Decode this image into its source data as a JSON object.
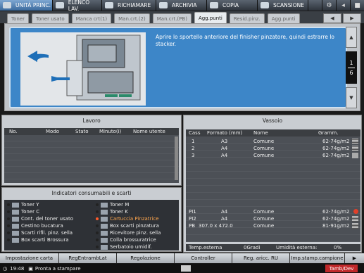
{
  "topbar": {
    "buttons": [
      "UNITÀ PRINC.",
      "ELENCO LAV.",
      "RICHIAMARE",
      "ARCHIVIA",
      "COPIA",
      "SCANSIONE"
    ]
  },
  "tabs": [
    "Toner",
    "Toner usato",
    "Manca crt(1)",
    "Man.crt.(2)",
    "Man.crt.(PB)",
    "Agg.punti",
    "Resid.pinz.",
    "Agg.punti"
  ],
  "message": "Aprire lo sportello anteriore del finisher pinzatore, quindi estrarre lo stacker.",
  "pager": {
    "current": "1",
    "total": "6"
  },
  "lavoro": {
    "title": "Lavoro",
    "columns": [
      "No.",
      "Modo",
      "Stato",
      "Minuto(i)",
      "Nome utente"
    ]
  },
  "consumabili": {
    "title": "Indicatori consumabili e scarti",
    "left": [
      "Toner Y",
      "Toner C",
      "Cont. del toner usato",
      "Cestino bucatura",
      "Scarti rifil. pinz. sella",
      "Box scarti Brossura"
    ],
    "right": [
      "Toner M",
      "Toner K",
      "Cartuccia Pinzatrice",
      "Box scarti pinzatura",
      "Ricevitore pinz. sella",
      "Colla brossuratrice",
      "Serbatoio umidif."
    ]
  },
  "vassoio": {
    "title": "Vassoio",
    "columns": [
      "Cass",
      "Formato (mm)",
      "Nome",
      "Gramm."
    ],
    "rows": [
      {
        "cass": "1",
        "formato": "A3",
        "nome": "Comune",
        "gramm": "62-74g/m2"
      },
      {
        "cass": "2",
        "formato": "A4",
        "nome": "Comune",
        "gramm": "62-74g/m2"
      },
      {
        "cass": "3",
        "formato": "A4",
        "nome": "Comune",
        "gramm": "62-74g/m2"
      },
      {
        "cass": "PI1",
        "formato": "A4",
        "nome": "Comune",
        "gramm": "62-74g/m2"
      },
      {
        "cass": "PI2",
        "formato": "A4",
        "nome": "Comune",
        "gramm": "62-74g/m2"
      },
      {
        "cass": "PB",
        "formato": "307.0 x 472.0",
        "nome": "Comune",
        "gramm": "81-91g/m2"
      }
    ],
    "temp_label": "Temp.esterna",
    "temp_value": "0Gradi",
    "humidity_label": "Umidità esterna:",
    "humidity_value": "0%"
  },
  "bottom": [
    "Impostazione carta",
    "RegEntrambLat",
    "Regolazione",
    "Controller",
    "Reg. aricc. RU",
    "Imp.stamp.campione"
  ],
  "status": {
    "time": "19:48",
    "text": "Pronta a stampare",
    "right": "Tamb/Dev"
  }
}
